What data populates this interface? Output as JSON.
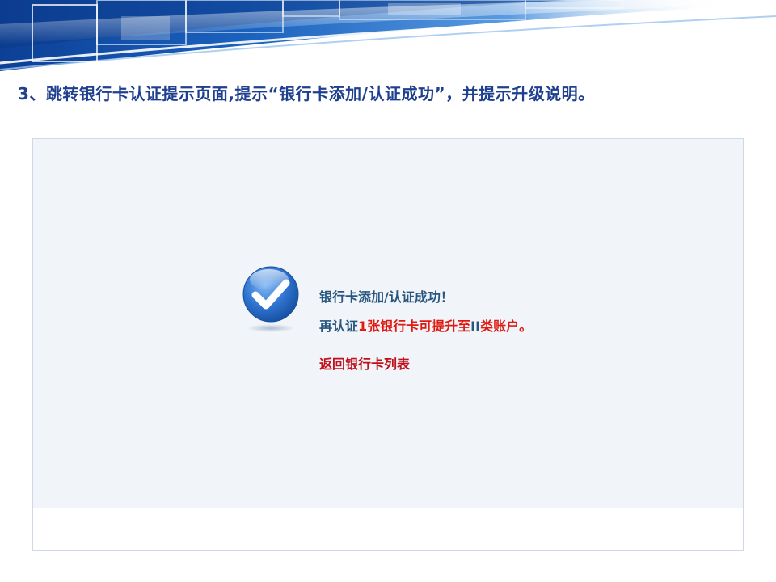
{
  "step_heading": "3、跳转银行卡认证提示页面,提示“银行卡添加/认证成功”，并提示升级说明。",
  "result": {
    "icon": "checkmark-circle-icon",
    "title": "银行卡添加/认证成功！",
    "upgrade_prefix": "再认证",
    "upgrade_highlight": "1张银行卡可提升至",
    "upgrade_tail_blue": "II",
    "upgrade_suffix": "类账户。",
    "back_link": "返回银行卡列表"
  },
  "colors": {
    "heading": "#1f3f8f",
    "message_blue": "#28567f",
    "highlight_red": "#e01a10",
    "link_red": "#c0101a",
    "panel_bg": "#f1f5fa"
  }
}
